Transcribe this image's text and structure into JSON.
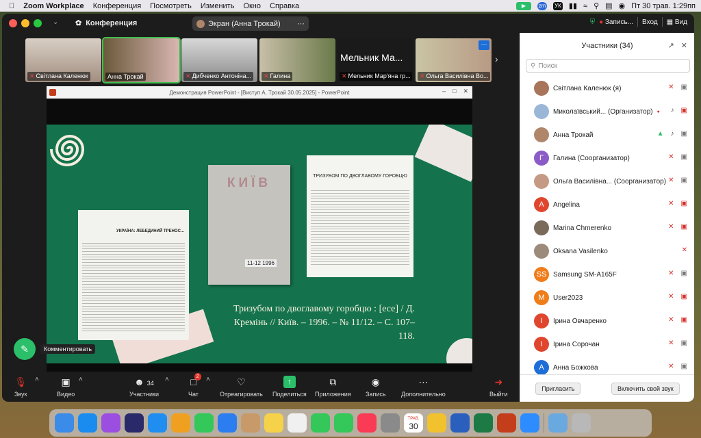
{
  "menubar": {
    "apple": "",
    "app": "Zoom Workplace",
    "items": [
      "Конференция",
      "Посмотреть",
      "Изменить",
      "Окно",
      "Справка"
    ],
    "status_lang": "УК",
    "datetime": "Пт 30 трав.  1:29пп"
  },
  "window": {
    "title": "Конференция",
    "share_pill": "Экран (Анна Трокай)",
    "record": "Запись...",
    "login": "Вход",
    "view": "Вид"
  },
  "thumbs": [
    {
      "name": "Світлана Каленюк",
      "muted": true
    },
    {
      "name": "Анна Трокай",
      "muted": false,
      "active": true
    },
    {
      "name": "Дибченко Антоніна...",
      "muted": true
    },
    {
      "name": "Галина",
      "muted": true
    },
    {
      "name": "Мельник Мар'яна гр...",
      "muted": true,
      "big": "Мельник Ма..."
    },
    {
      "name": "Ольга Василівна Во...",
      "muted": true
    }
  ],
  "ppt": {
    "title": "Демонстрация PowerPoint - [Виступ А. Трокай 30.05.2025] - PowerPoint"
  },
  "slide": {
    "doc1_heading": "УКРАЇНА: ЛЕБЕДИНИЙ ТРЕНОС...",
    "book_title": "КИЇВ",
    "book_year": "11-12 1996",
    "doc2_heading": "ТРИЗУБОМ ПО ДВОГЛАВОМУ ГОРОБЦЮ",
    "citation": "Тризубом по двоглавому горобцю : [есе] / Д. Кремінь // Київ. – 1996. – № 11/12. – С. 107–118."
  },
  "annotate": {
    "tooltip": "Комментировать"
  },
  "toolbar": {
    "audio": "Звук",
    "video": "Видео",
    "participants": "Участники",
    "participants_count": "34",
    "chat": "Чат",
    "chat_badge": "2",
    "react": "Отреагировать",
    "share": "Поделиться",
    "apps": "Приложения",
    "record": "Запись",
    "more": "Дополнительно",
    "leave": "Выйти"
  },
  "panel": {
    "title": "Участники (34)",
    "search_placeholder": "Поиск",
    "participants": [
      {
        "name": "Світлана Каленюк (я)",
        "initial": "",
        "color": "#a8755a",
        "muted": true,
        "cam_off": false
      },
      {
        "name": "Миколаївський... (Организатор)",
        "initial": "",
        "color": "#9ab7d8",
        "muted": false,
        "cam_off": true,
        "rec": true
      },
      {
        "name": "Анна Трокай",
        "initial": "",
        "color": "#b0866a",
        "muted": false,
        "cam_off": false,
        "sharing": true
      },
      {
        "name": "Галина (Соорганизатор)",
        "initial": "Г",
        "color": "#8b5cc7",
        "muted": true,
        "cam_off": false
      },
      {
        "name": "Ольга Василівна... (Соорганизатор)",
        "initial": "",
        "color": "#c49a84",
        "muted": true,
        "cam_off": false
      },
      {
        "name": "Angelina",
        "initial": "A",
        "color": "#e0462d",
        "muted": true,
        "cam_off": true
      },
      {
        "name": "Marina Chmerenko",
        "initial": "",
        "color": "#7a6a5a",
        "muted": true,
        "cam_off": true
      },
      {
        "name": "Oksana Vasilenko",
        "initial": "",
        "color": "#9c8a7a",
        "muted": true,
        "cam_off": false,
        "no_cam": true
      },
      {
        "name": "Samsung SM-A165F",
        "initial": "SS",
        "color": "#ef7d1a",
        "muted": true,
        "cam_off": false
      },
      {
        "name": "User2023",
        "initial": "M",
        "color": "#ef7d1a",
        "muted": true,
        "cam_off": true
      },
      {
        "name": "Ірина Овчаренко",
        "initial": "І",
        "color": "#e0462d",
        "muted": true,
        "cam_off": true
      },
      {
        "name": "Ірина Сорочан",
        "initial": "І",
        "color": "#e0462d",
        "muted": true,
        "cam_off": false
      },
      {
        "name": "Анна Божкова",
        "initial": "А",
        "color": "#1e6ed8",
        "muted": true,
        "cam_off": false
      }
    ],
    "invite": "Пригласить",
    "unmute": "Включить свой звук"
  },
  "dock": {
    "calendar_month": "ТРАВ.",
    "calendar_day": "30",
    "items": [
      "finder",
      "app-store",
      "podcasts",
      "siri",
      "safari",
      "pages",
      "messages",
      "mail",
      "contacts",
      "notes",
      "reminders",
      "maps",
      "facetime",
      "music",
      "system-settings",
      "calendar",
      "chrome",
      "word",
      "excel",
      "powerpoint",
      "zoom",
      "downloads",
      "trash"
    ]
  }
}
